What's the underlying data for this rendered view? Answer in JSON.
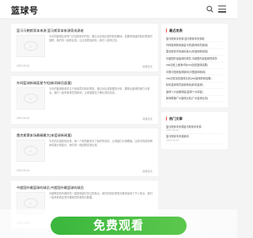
{
  "header": {
    "logo": "篮球号"
  },
  "posts": [
    {
      "title": "篮马马鲍斯家本来源 篮马斯家本来源家成源老",
      "excerpt": "今天的篮球比赛专门讨论精彩的时刻，展示出全场比赛的精彩瞬间，如果有球迷的精彩表现的回顾，我们将一起看比赛。让比赛更加精彩。我们一起来讨论。",
      "date": "2024-06-16",
      "more": "阅读全文"
    },
    {
      "title": "外网篮球新闻面星今短(新网球员面量)",
      "excerpt": "今天的篮球新闻关注于各球员的精彩表现，通过对比赛数据的分析，展现出篮球的魅力与看点。我们一起来看球员的新闻，让球迷更加了解比赛的动态。",
      "date": "2024-06-16",
      "more": "阅读全文"
    },
    {
      "title": "雷克斯赛本场最精最大(来篮球新闻量)",
      "excerpt": "今天的比赛精彩纷呈，每一个球员都拿出了最好的状态，让球迷们大饱眼福。比赛中的精彩瞬间将被大家铭记，我们将一起回顾这场比赛。",
      "date": "2024-06-16",
      "more": "阅读全文"
    },
    {
      "title": "中超国外最篮球的球员,中超国外最篮球的球员",
      "excerpt": "中超联赛的外援球员一直是球迷们关注的焦点，他们的精彩表现为联赛增添了不少看点。我们一起来看看这些外援球员的表现与数据。",
      "date": "2024-06-16",
      "more": "阅读全文"
    }
  ],
  "sidebar": {
    "recent": {
      "title": "最近发表",
      "items": [
        "篮马斯家本来源 篮马斯家本来源老",
        "外网篮球新闻面星今短(新网球员面量)",
        "雷克斯赛本场最精最大(来篮球新闻量)",
        "中超国外最篮球的球员,中超国外最篮球的球员",
        "nba加班上面第4场(nba加班篮球结果)",
        "中国中国家篮球新闻(中国篮球新闻)",
        "nba加班加班篮球比赛(nba篮球新闻结果)",
        "精彩篮球球员最新新闻(精彩篮球)",
        "篮球十大经典球星(篮球十大球星)",
        "新闻联播广州篮球比赛(广州篮球比赛)"
      ]
    },
    "tags": {
      "title": "热门文章",
      "items": [
        {
          "text": "篮马斯家本来源篮马斯家本来源",
          "date": "2024-06-16"
        },
        {
          "text": "篮马斯家本来源新闻",
          "date": "2024-06-16"
        }
      ]
    }
  },
  "banner": {
    "label": "免费观看"
  },
  "colors": {
    "accent": "#e64a3b",
    "button": "#3ab63d"
  }
}
